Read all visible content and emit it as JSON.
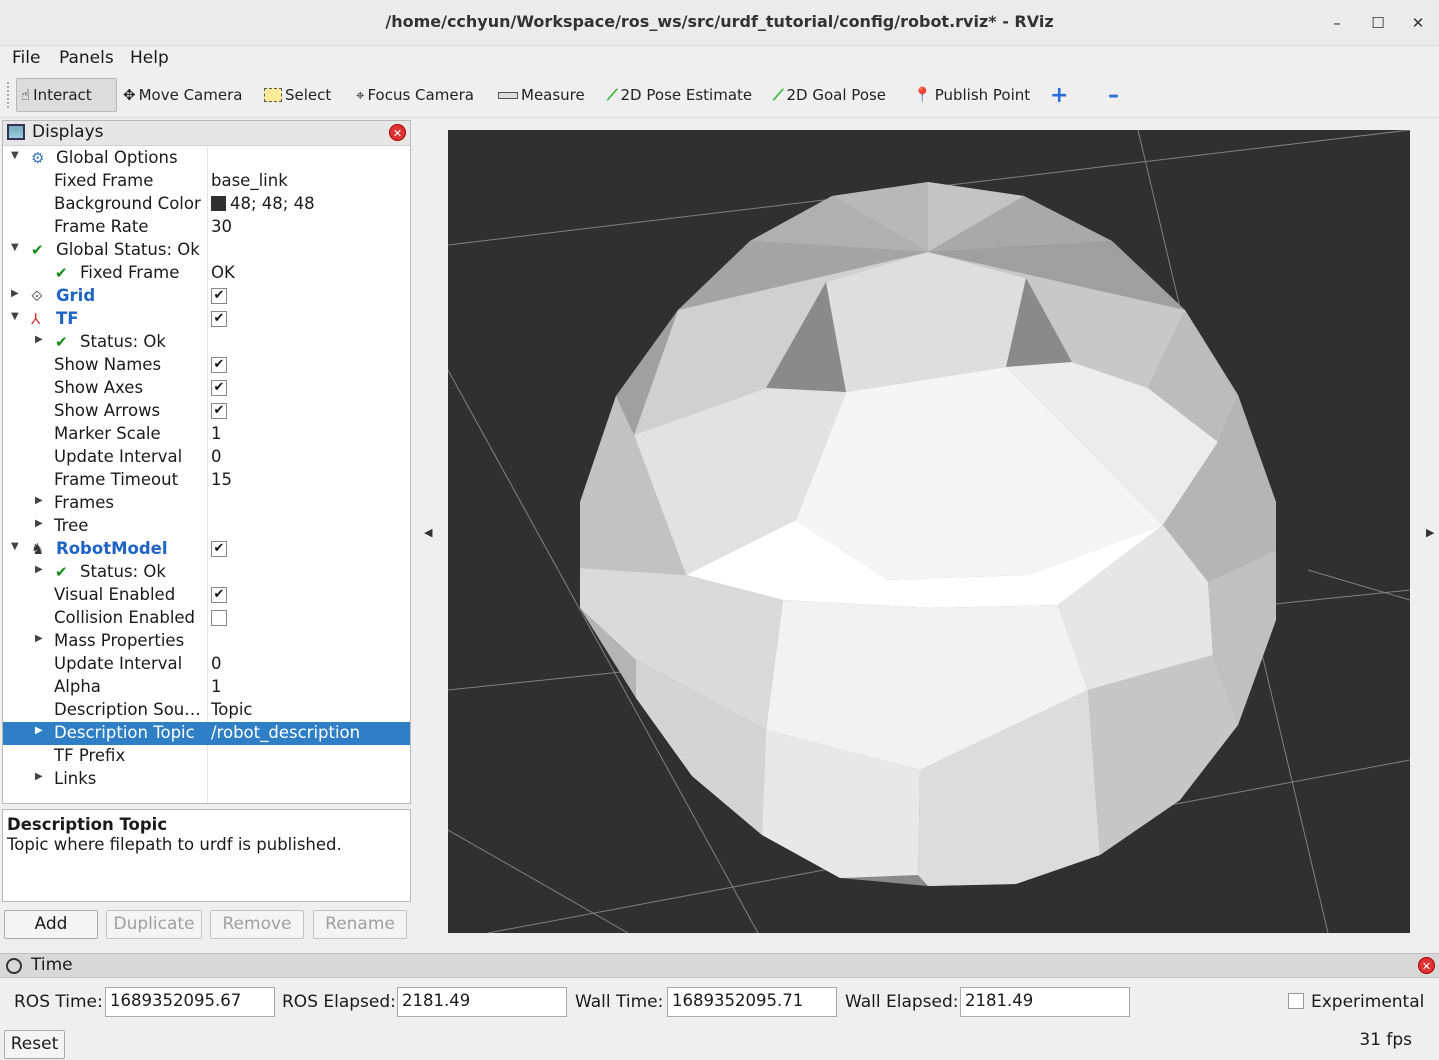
{
  "window": {
    "title": "/home/cchyun/Workspace/ros_ws/src/urdf_tutorial/config/robot.rviz* - RViz",
    "minimize": "–",
    "maximize": "☐",
    "close": "✕"
  },
  "menu": {
    "file": "File",
    "panels": "Panels",
    "help": "Help"
  },
  "toolbar": {
    "interact": "Interact",
    "move_camera": "Move Camera",
    "select": "Select",
    "focus_camera": "Focus Camera",
    "measure": "Measure",
    "pose_estimate": "2D Pose Estimate",
    "goal_pose": "2D Goal Pose",
    "publish_point": "Publish Point",
    "add_tool": "+",
    "remove_tool": "–"
  },
  "displays": {
    "title": "Displays",
    "rows": {
      "global_options": "Global Options",
      "fixed_frame": "Fixed Frame",
      "fixed_frame_val": "base_link",
      "bg_color": "Background Color",
      "bg_color_val": "48; 48; 48",
      "frame_rate": "Frame Rate",
      "frame_rate_val": "30",
      "global_status": "Global Status: Ok",
      "status_fixed_frame": "Fixed Frame",
      "status_fixed_frame_val": "OK",
      "grid": "Grid",
      "tf": "TF",
      "tf_status": "Status: Ok",
      "show_names": "Show Names",
      "show_axes": "Show Axes",
      "show_arrows": "Show Arrows",
      "marker_scale": "Marker Scale",
      "marker_scale_val": "1",
      "update_interval": "Update Interval",
      "update_interval_val": "0",
      "frame_timeout": "Frame Timeout",
      "frame_timeout_val": "15",
      "frames": "Frames",
      "tree": "Tree",
      "robot_model": "RobotModel",
      "rm_status": "Status: Ok",
      "visual_enabled": "Visual Enabled",
      "collision_enabled": "Collision Enabled",
      "mass_properties": "Mass Properties",
      "rm_update_interval": "Update Interval",
      "rm_update_interval_val": "0",
      "alpha": "Alpha",
      "alpha_val": "1",
      "description_source": "Description Sou…",
      "description_source_val": "Topic",
      "description_topic": "Description Topic",
      "description_topic_val": "/robot_description",
      "tf_prefix": "TF Prefix",
      "links": "Links"
    },
    "background_color_hex": "#303030",
    "selection_color": "#2f7fc6"
  },
  "description": {
    "title": "Description Topic",
    "text": "Topic where filepath to urdf is published."
  },
  "buttons": {
    "add": "Add",
    "duplicate": "Duplicate",
    "remove": "Remove",
    "rename": "Rename"
  },
  "time": {
    "title": "Time",
    "ros_time_label": "ROS Time:",
    "ros_time": "1689352095.67",
    "ros_elapsed_label": "ROS Elapsed:",
    "ros_elapsed": "2181.49",
    "wall_time_label": "Wall Time:",
    "wall_time": "1689352095.71",
    "wall_elapsed_label": "Wall Elapsed:",
    "wall_elapsed": "2181.49",
    "experimental": "Experimental",
    "reset": "Reset",
    "fps": "31 fps"
  }
}
